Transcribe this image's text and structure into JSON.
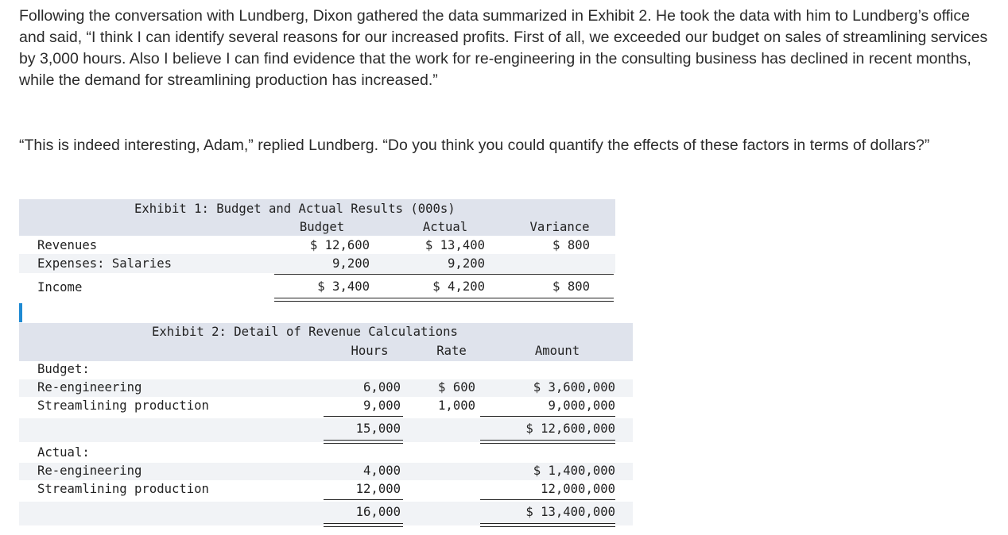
{
  "paragraphs": {
    "p1": "Following the conversation with Lundberg, Dixon gathered the data summarized in Exhibit 2. He took the data with him to Lundberg’s office and said, “I think I can identify several reasons for our increased profits. First of all, we exceeded our budget on sales of streamlining services by 3,000 hours. Also I believe I can find evidence that the work for re-engineering in the consulting business has declined in recent months, while the demand for streamlining production has increased.”",
    "p2": "“This is indeed interesting, Adam,” replied Lundberg. “Do you think you could quantify the effects of these factors in terms of dollars?”"
  },
  "exhibit1": {
    "title": "Exhibit 1: Budget and Actual Results (000s)",
    "headers": {
      "budget": "Budget",
      "actual": "Actual",
      "variance": "Variance"
    },
    "rows": {
      "revenues": {
        "label": "Revenues",
        "budget": "$ 12,600",
        "actual": "$ 13,400",
        "variance": "$ 800"
      },
      "salaries": {
        "label": "Expenses: Salaries",
        "budget": "9,200",
        "actual": "9,200"
      },
      "income": {
        "label": "Income",
        "budget": "$ 3,400",
        "actual": "$ 4,200",
        "variance": "$ 800"
      }
    }
  },
  "exhibit2": {
    "title": "Exhibit 2: Detail of Revenue Calculations",
    "headers": {
      "hours": "Hours",
      "rate": "Rate",
      "amount": "Amount"
    },
    "budget": {
      "label": "Budget:",
      "reeng": {
        "label": "Re-engineering",
        "hours": "6,000",
        "rate": "$ 600",
        "amount": "$ 3,600,000"
      },
      "stream": {
        "label": "Streamlining production",
        "hours": "9,000",
        "rate": "1,000",
        "amount": "9,000,000"
      },
      "total": {
        "hours": "15,000",
        "amount": "$ 12,600,000"
      }
    },
    "actual": {
      "label": "Actual:",
      "reeng": {
        "label": "Re-engineering",
        "hours": "4,000",
        "amount": "$ 1,400,000"
      },
      "stream": {
        "label": "Streamlining production",
        "hours": "12,000",
        "amount": "12,000,000"
      },
      "total": {
        "hours": "16,000",
        "amount": "$ 13,400,000"
      }
    }
  }
}
